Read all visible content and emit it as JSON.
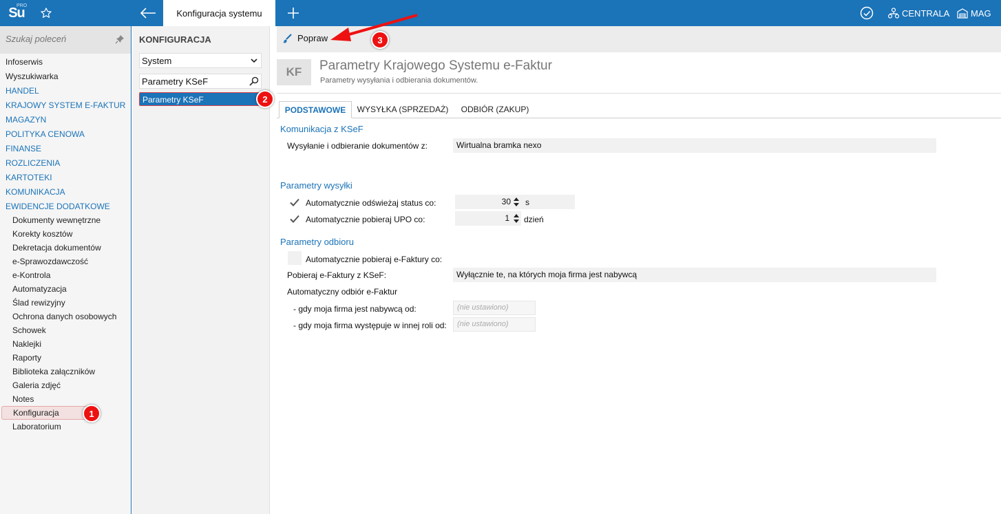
{
  "topbar": {
    "logo_text": "Su",
    "logo_badge": "PRO",
    "active_tab": "Konfiguracja systemu",
    "centrala": "CENTRALA",
    "mag": "MAG"
  },
  "sidebar": {
    "search_placeholder": "Szukaj poleceń",
    "items": [
      "Infoserwis",
      "Wyszukiwarka",
      "HANDEL",
      "KRAJOWY SYSTEM E-FAKTUR",
      "MAGAZYN",
      "POLITYKA CENOWA",
      "FINANSE",
      "ROZLICZENIA",
      "KARTOTEKI",
      "KOMUNIKACJA",
      "EWIDENCJE DODATKOWE"
    ],
    "subitems": [
      "Dokumenty wewnętrzne",
      "Korekty kosztów",
      "Dekretacja dokumentów",
      "e-Sprawozdawczość",
      "e-Kontrola",
      "Automatyzacja",
      "Ślad rewizyjny",
      "Ochrona danych osobowych",
      "Schowek",
      "Naklejki",
      "Raporty",
      "Biblioteka załączników",
      "Galeria zdjęć",
      "Notes",
      "Konfiguracja",
      "Laboratorium"
    ]
  },
  "config": {
    "title": "KONFIGURACJA",
    "select_value": "System",
    "search_value": "Parametry KSeF",
    "selected_item": "Parametry KSeF"
  },
  "toolbar": {
    "edit_label": "Popraw"
  },
  "header": {
    "badge": "KF",
    "title": "Parametry Krajowego Systemu e-Faktur",
    "subtitle": "Parametry wysyłania i odbierania dokumentów."
  },
  "tabs": [
    "PODSTAWOWE",
    "WYSYŁKA (SPRZEDAŻ)",
    "ODBIÓR (ZAKUP)"
  ],
  "form": {
    "komunikacja_title": "Komunikacja z KSeF",
    "send_receive_label": "Wysyłanie i odbieranie dokumentów z:",
    "send_receive_value": "Wirtualna bramka nexo",
    "wysylka_title": "Parametry wysyłki",
    "refresh_label": "Automatycznie odświeżaj status co:",
    "refresh_value": "30",
    "refresh_unit": "s",
    "upo_label": "Automatycznie pobieraj UPO co:",
    "upo_value": "1",
    "upo_unit": "dzień",
    "odbior_title": "Parametry odbioru",
    "auto_fetch_label": "Automatycznie pobieraj e-Faktury co:",
    "fetch_from_label": "Pobieraj e-Faktury z KSeF:",
    "fetch_from_value": "Wyłącznie te, na których moja firma jest nabywcą",
    "auto_receive_label": "Automatyczny odbiór e-Faktur",
    "buyer_label": "- gdy moja firma jest nabywcą od:",
    "buyer_value": "(nie ustawiono)",
    "other_role_label": "- gdy moja firma występuje w innej roli od:",
    "other_role_value": "(nie ustawiono)"
  },
  "annotations": [
    "1",
    "2",
    "3"
  ],
  "colors": {
    "brand": "#1b73b8",
    "annotation": "#e11111"
  }
}
